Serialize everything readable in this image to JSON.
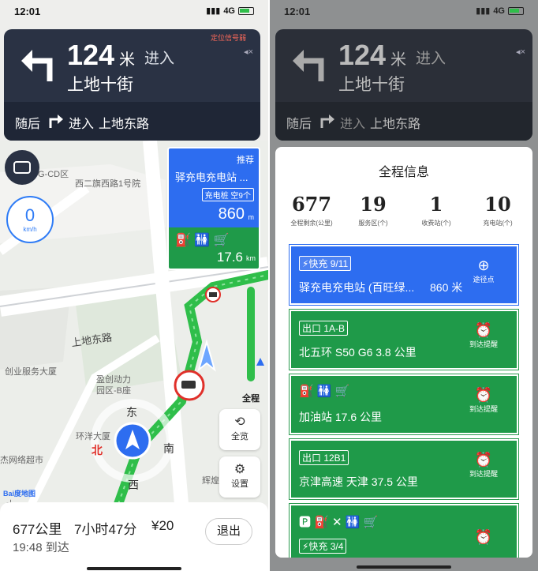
{
  "left": {
    "status": {
      "time": "12:01",
      "network": "4G"
    },
    "nav": {
      "distance": "124",
      "unit": "米",
      "into": "进入",
      "road": "上地十街",
      "alert": "定位信号弱",
      "then_label": "随后",
      "then_into": "进入",
      "then_road": "上地东路"
    },
    "map_labels": [
      "G-CD区",
      "西二旗西路1号院",
      "上地东路",
      "创业服务大厦",
      "盈创动力",
      "园区-B座",
      "环洋大厦",
      "杰网络超市",
      "辉煌",
      "大"
    ],
    "compass": {
      "n": "北",
      "e": "东",
      "s": "南",
      "w": "西"
    },
    "speed": {
      "value": "0",
      "unit": "km/h"
    },
    "card": {
      "tag": "推荐",
      "name": "驿充电充电站 ...",
      "chg": "充电桩 空9个",
      "dist": "860",
      "dunit": "m",
      "dist2": "17.6",
      "dunit2": "km"
    },
    "buttons": {
      "full": "全程",
      "overview": "全览",
      "settings": "设置"
    },
    "bottom": {
      "distance": "677公里",
      "time": "7小时47分",
      "toll": "¥20",
      "arrive": "19:48 到达",
      "exit": "退出"
    },
    "logo": "Bai度地图"
  },
  "right": {
    "status": {
      "time": "12:01",
      "network": "4G"
    },
    "nav": {
      "distance": "124",
      "unit": "米",
      "into": "进入",
      "road": "上地十街",
      "then_label": "随后",
      "then_into": "进入",
      "then_road": "上地东路"
    },
    "panel": {
      "title": "全程信息",
      "stats": [
        {
          "n": "677",
          "c": "全程剩余(公里)"
        },
        {
          "n": "19",
          "c": "服务区(个)"
        },
        {
          "n": "1",
          "c": "收费站(个)"
        },
        {
          "n": "10",
          "c": "充电站(个)"
        }
      ],
      "rows": [
        {
          "tag": "⚡快充 9/11",
          "text": "驿充电充电站 (百旺绿...",
          "dist": "860 米",
          "action": "途径点",
          "color": "#2d6df0"
        },
        {
          "tag": "出口 1A-B",
          "text": "北五环 S50 G6  3.8 公里",
          "action": "到达提醒",
          "color": "#1f9a49"
        },
        {
          "tag": "",
          "text": "加油站  17.6 公里",
          "action": "到达提醒",
          "color": "#1f9a49"
        },
        {
          "tag": "出口 12B1",
          "text": "京津高速 天津  37.5 公里",
          "action": "到达提醒",
          "color": "#1f9a49"
        },
        {
          "tag": "⚡快充 3/4",
          "text": "",
          "action": "",
          "color": "#1f9a49"
        }
      ]
    }
  },
  "colors": {
    "nav_bg": "#2a3244",
    "blue": "#2d6df0",
    "green": "#1f9a49",
    "route": "#2fbe4a"
  }
}
